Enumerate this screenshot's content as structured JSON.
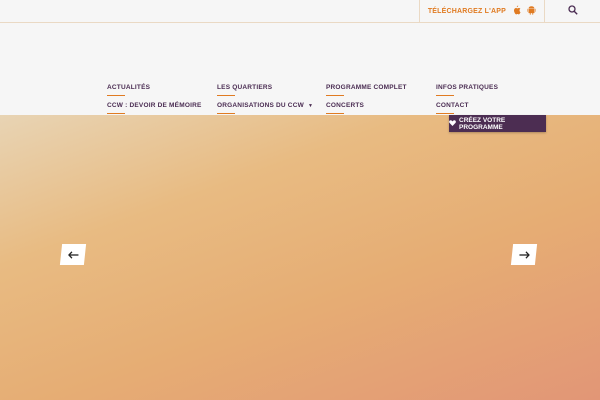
{
  "topbar": {
    "app_download_label": "TÉLÉCHARGEZ L'APP"
  },
  "nav": {
    "items": [
      {
        "label": "ACTUALITÉS"
      },
      {
        "label": "LES QUARTIERS"
      },
      {
        "label": "PROGRAMME COMPLET"
      },
      {
        "label": "INFOS PRATIQUES"
      },
      {
        "label": "CCW : DEVOIR DE MÉMOIRE"
      },
      {
        "label": "ORGANISATIONS DU CCW"
      },
      {
        "label": "CONCERTS"
      },
      {
        "label": "CONTACT"
      }
    ]
  },
  "cta": {
    "label": "CRÉEZ VOTRE PROGRAMME"
  },
  "colors": {
    "accent": "#e07b22",
    "brand_purple": "#4c2d52"
  }
}
